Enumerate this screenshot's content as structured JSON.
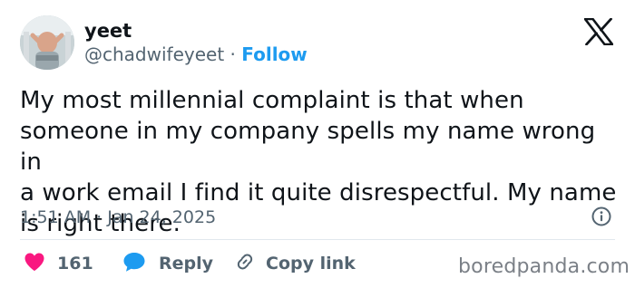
{
  "author": {
    "name": "yeet",
    "handle": "@chadwifeyeet",
    "separator": "·",
    "follow_label": "Follow"
  },
  "tweet": {
    "text": "My most millennial complaint is that when\nsomeone in my company spells my name wrong in\na work email I find it quite disrespectful. My name\nis right there.",
    "timestamp": "1:51 AM · Jan 24, 2025"
  },
  "actions": {
    "like_count": "161",
    "reply_label": "Reply",
    "copy_label": "Copy link"
  },
  "watermark": "boredpanda.com",
  "icons": {
    "brand": "x-logo-icon",
    "info": "info-icon",
    "like": "heart-icon",
    "reply": "speech-bubble-icon",
    "copy": "link-icon"
  },
  "colors": {
    "accent": "#1d9bf0",
    "like": "#f91880",
    "text": "#0f1419",
    "muted": "#536471"
  }
}
